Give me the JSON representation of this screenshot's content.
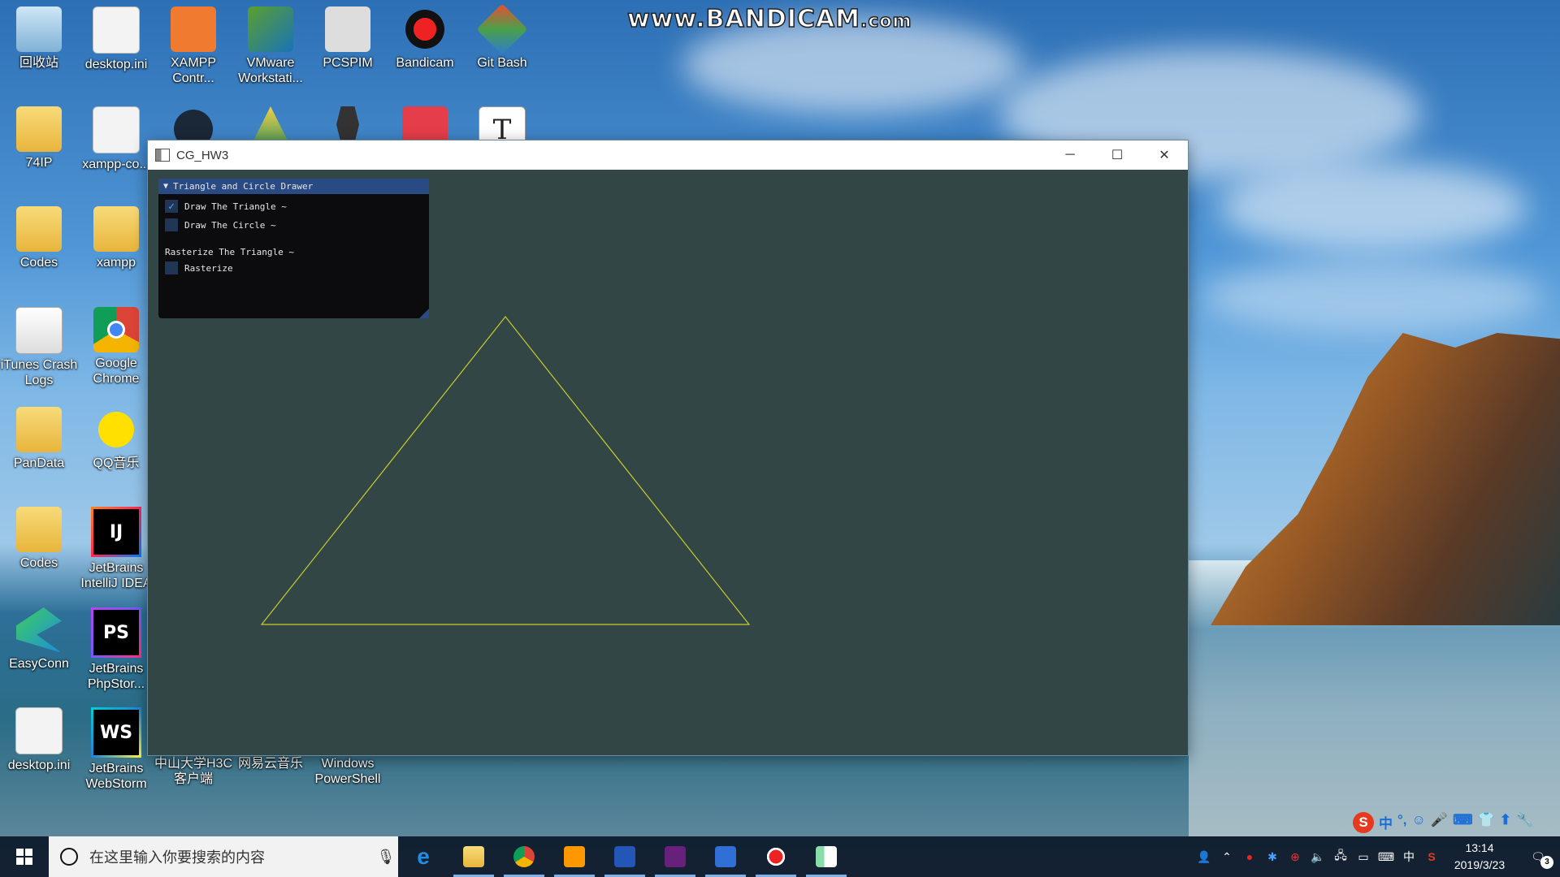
{
  "watermark": {
    "main": "www.BANDICAM",
    "suffix": ".com"
  },
  "desktop_icons": [
    {
      "label": "回收站",
      "icon": "recycle-bin-icon"
    },
    {
      "label": "desktop.ini",
      "icon": "settings-file-icon"
    },
    {
      "label": "XAMPP Contr...",
      "icon": "xampp-icon"
    },
    {
      "label": "VMware Workstati...",
      "icon": "vmware-icon"
    },
    {
      "label": "PCSPIM",
      "icon": "pcspim-icon"
    },
    {
      "label": "Bandicam",
      "icon": "bandicam-icon"
    },
    {
      "label": "Git Bash",
      "icon": "git-bash-icon"
    },
    {
      "label": "74IP",
      "icon": "folder-icon"
    },
    {
      "label": "xampp-co...",
      "icon": "settings-file-icon"
    },
    {
      "label": "",
      "icon": "steam-icon"
    },
    {
      "label": "",
      "icon": "blade-icon"
    },
    {
      "label": "",
      "icon": "lamp-icon"
    },
    {
      "label": "",
      "icon": "xmind-icon"
    },
    {
      "label": "T",
      "icon": "typora-icon"
    },
    {
      "label": "Codes",
      "icon": "folder-icon"
    },
    {
      "label": "xampp",
      "icon": "folder-shortcut-icon"
    },
    {
      "label": "iTunes Crash Logs",
      "icon": "itunes-logs-icon"
    },
    {
      "label": "Google Chrome",
      "icon": "chrome-icon"
    },
    {
      "label": "PanData",
      "icon": "folder-icon"
    },
    {
      "label": "QQ音乐",
      "icon": "qq-music-icon"
    },
    {
      "label": "Codes",
      "icon": "folder-shortcut-icon"
    },
    {
      "label": "JetBrains IntelliJ IDEA",
      "icon": "intellij-icon",
      "glyph": "IJ"
    },
    {
      "label": "EasyConn",
      "icon": "easyconn-icon"
    },
    {
      "label": "JetBrains PhpStor...",
      "icon": "phpstorm-icon",
      "glyph": "PS"
    },
    {
      "label": "desktop.ini",
      "icon": "settings-file-icon"
    },
    {
      "label": "JetBrains WebStorm",
      "icon": "webstorm-icon",
      "glyph": "WS"
    },
    {
      "label": "中山大学H3C 客户端",
      "icon": "h3c-icon"
    },
    {
      "label": "网易云音乐",
      "icon": "netease-music-icon"
    },
    {
      "label": "Windows PowerShell",
      "icon": "powershell-icon"
    }
  ],
  "window": {
    "title": "CG_HW3",
    "minimize": "─",
    "maximize": "☐",
    "close": "✕"
  },
  "imgui": {
    "header": "Triangle and Circle Drawer",
    "header_arrow": "▼",
    "draw_triangle": {
      "label": "Draw The Triangle ~",
      "checked": true
    },
    "draw_circle": {
      "label": "Draw The Circle ~",
      "checked": false
    },
    "rasterize_heading": "Rasterize The Triangle ~",
    "rasterize": {
      "label": "Rasterize",
      "checked": false
    },
    "check_glyph": "✓"
  },
  "scene": {
    "background": "#334646",
    "triangle_color": "#c8cc2e"
  },
  "taskbar": {
    "search_placeholder": "在这里输入你要搜索的内容",
    "apps": [
      "edge-icon",
      "file-explorer-icon",
      "chrome-icon",
      "sublime-text-icon",
      "powershell-icon",
      "visual-studio-icon",
      "wps-icon",
      "bandicam-record-icon",
      "cg-hw3-icon"
    ],
    "ime_lang": "中",
    "time": "13:14",
    "date": "2019/3/23",
    "notification_count": "3"
  },
  "ime_toolbar": [
    "S",
    "中",
    "°,",
    "☺",
    "🎤",
    "⌨",
    "👕",
    "⬆",
    "🔧"
  ]
}
